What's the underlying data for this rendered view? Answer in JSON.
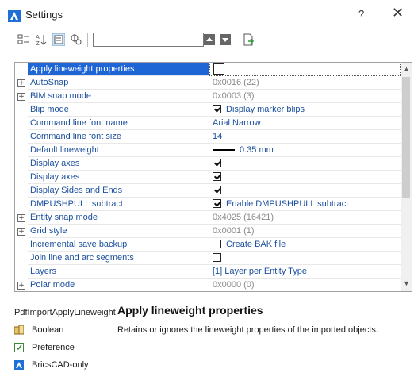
{
  "window": {
    "title": "Settings",
    "help_label": "?",
    "close_label": "✕"
  },
  "toolbar": {
    "search_value": ""
  },
  "rows": [
    {
      "name": "Apply lineweight properties",
      "value": "",
      "type": "checkbox",
      "checked": false,
      "selected": true,
      "expandable": false
    },
    {
      "name": "AutoSnap",
      "value": "0x0016 (22)",
      "type": "text",
      "muted": true,
      "expandable": true
    },
    {
      "name": "BIM snap mode",
      "value": "0x0003 (3)",
      "type": "text",
      "muted": true,
      "expandable": true
    },
    {
      "name": "Blip mode",
      "value": "Display marker blips",
      "type": "checkbox",
      "checked": true,
      "expandable": false
    },
    {
      "name": "Command line font name",
      "value": "Arial Narrow",
      "type": "text",
      "expandable": false
    },
    {
      "name": "Command line font size",
      "value": "14",
      "type": "text",
      "expandable": false
    },
    {
      "name": "Default lineweight",
      "value": "0.35 mm",
      "type": "lineweight",
      "expandable": false
    },
    {
      "name": "Display axes",
      "value": "",
      "type": "checkbox",
      "checked": true,
      "expandable": false
    },
    {
      "name": "Display axes",
      "value": "",
      "type": "checkbox",
      "checked": true,
      "expandable": false
    },
    {
      "name": "Display Sides and Ends",
      "value": "",
      "type": "checkbox",
      "checked": true,
      "expandable": false
    },
    {
      "name": "DMPUSHPULL subtract",
      "value": "Enable DMPUSHPULL subtract",
      "type": "checkbox",
      "checked": true,
      "expandable": false
    },
    {
      "name": "Entity snap mode",
      "value": "0x4025 (16421)",
      "type": "text",
      "muted": true,
      "expandable": true
    },
    {
      "name": "Grid style",
      "value": "0x0001 (1)",
      "type": "text",
      "muted": true,
      "expandable": true
    },
    {
      "name": "Incremental save backup",
      "value": "Create BAK file",
      "type": "checkbox",
      "checked": false,
      "expandable": false
    },
    {
      "name": "Join line and arc segments",
      "value": "",
      "type": "checkbox",
      "checked": false,
      "expandable": false
    },
    {
      "name": "Layers",
      "value": "[1] Layer per Entity Type",
      "type": "text",
      "expandable": false
    },
    {
      "name": "Polar mode",
      "value": "0x0000 (0)",
      "type": "text",
      "muted": true,
      "expandable": true
    }
  ],
  "detail": {
    "variable_name": "PdfImportApplyLineweight",
    "title": "Apply lineweight properties",
    "type_label": "Boolean",
    "category_label": "Preference",
    "scope_label": "BricsCAD-only",
    "description": "Retains or ignores the lineweight properties of the imported objects."
  },
  "colors": {
    "accent": "#1e66d6",
    "label_text": "#1b4f9c",
    "muted_text": "#8a8a8a"
  }
}
